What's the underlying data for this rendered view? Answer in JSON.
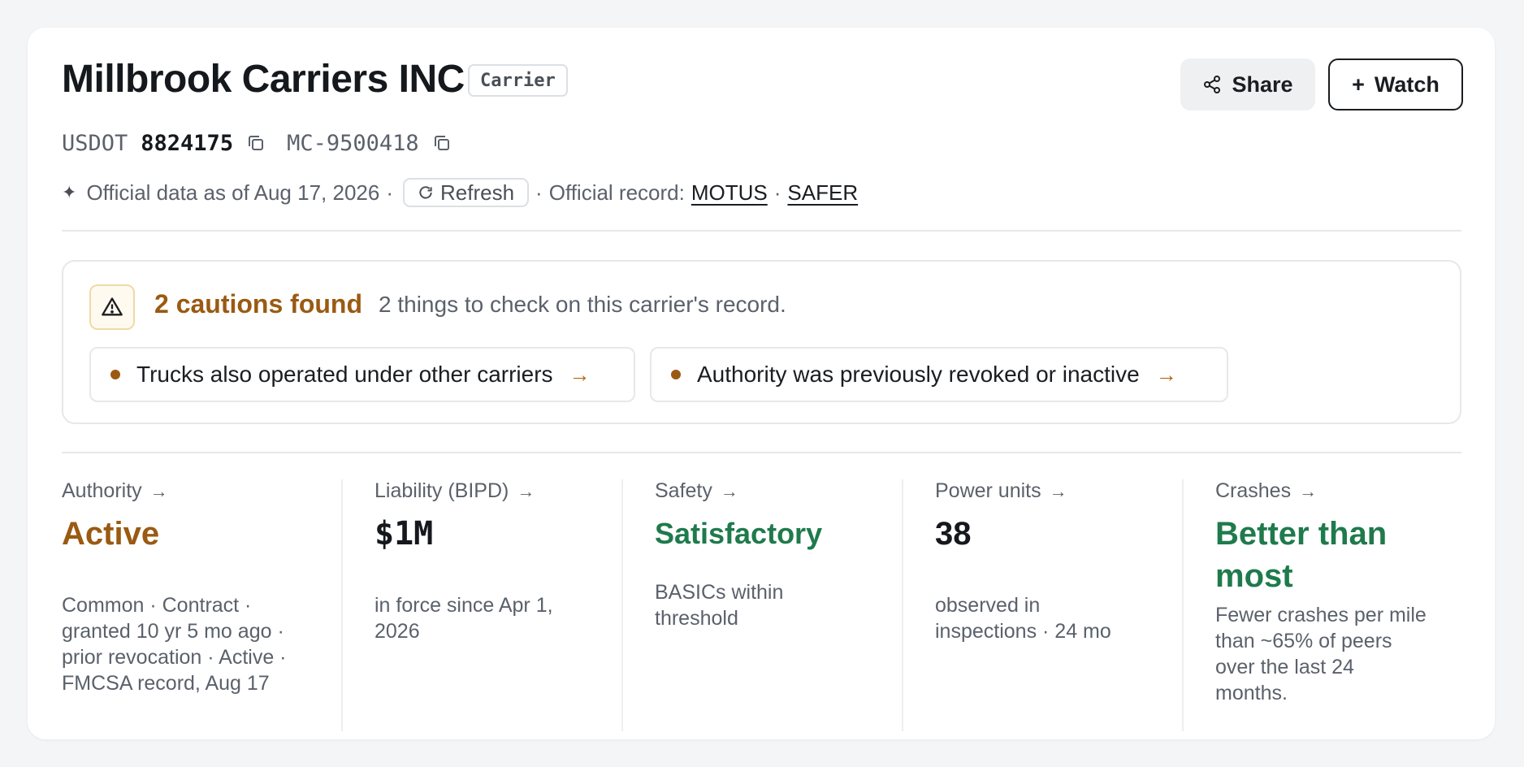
{
  "header": {
    "title": "Millbrook Carriers INC",
    "tag": "Carrier",
    "share_label": "Share",
    "watch_label": "Watch",
    "watch_prefix": "+"
  },
  "ids": {
    "usdot_label": "USDOT",
    "usdot_number": "8824175",
    "mc_number": "MC-9500418"
  },
  "meta": {
    "sparkle": "✦",
    "official_data": "Official data as of Aug 17, 2026",
    "sep1": "·",
    "refresh_label": "Refresh",
    "sep2": "·",
    "official_record": "Official record:",
    "link_motus": "MOTUS",
    "sep3": "·",
    "link_safer": "SAFER"
  },
  "alert": {
    "title": "2 cautions found",
    "subtitle": "2 things to check on this carrier's record.",
    "items": [
      {
        "label": "Trucks also operated under other carriers",
        "arrow": "→"
      },
      {
        "label": "Authority was previously revoked or inactive",
        "arrow": "→"
      }
    ]
  },
  "stats": [
    {
      "label": "Authority",
      "value": "Active",
      "value_color": "#9a5a12",
      "desc": [
        "Common · Contract ·",
        "granted 10 yr 5 mo ago ·",
        "prior revocation · Active ·",
        "FMCSA record, Aug 17"
      ]
    },
    {
      "label": "Liability (BIPD)",
      "value": "$1M",
      "value_color": "#15181c",
      "desc": [
        "in force since Apr 1,",
        "2026"
      ]
    },
    {
      "label": "Safety",
      "value": "Satisfactory",
      "value_color": "#1f7a4c",
      "desc": [
        "BASICs within",
        "threshold"
      ]
    },
    {
      "label": "Power units",
      "value": "38",
      "value_color": "#15181c",
      "desc": [
        "observed in",
        "inspections · 24 mo"
      ]
    },
    {
      "label": "Crashes",
      "value": [
        "Better than",
        "most"
      ],
      "value_color": "#1f7a4c",
      "desc": [
        "Fewer crashes per mile",
        "than ~65% of peers",
        "over the last 24",
        "months."
      ]
    }
  ],
  "icons": {
    "share": "share-icon",
    "copy": "copy-icon",
    "refresh": "refresh-icon",
    "warning": "warning-icon",
    "arrow": "arrow-right-icon"
  }
}
